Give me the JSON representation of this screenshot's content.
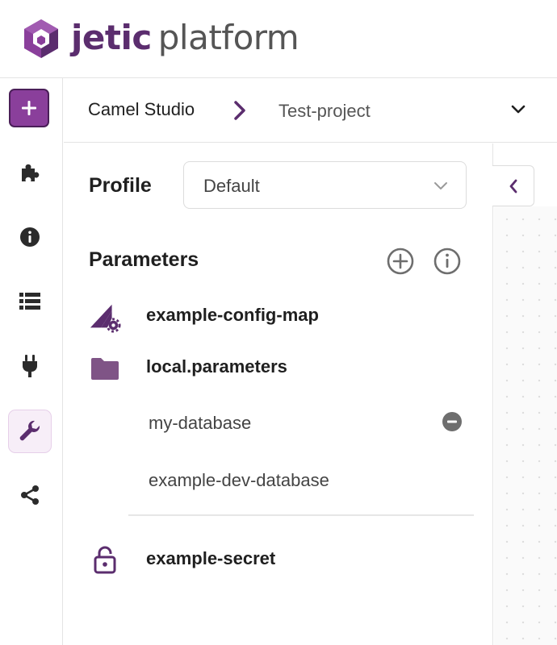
{
  "header": {
    "brand_primary": "jetic",
    "brand_secondary": "platform",
    "logo_icon": "jetic-cube-logo"
  },
  "rail": {
    "items": [
      {
        "icon": "plus-icon",
        "active": false
      },
      {
        "icon": "puzzle-icon",
        "active": false
      },
      {
        "icon": "info-icon",
        "active": false
      },
      {
        "icon": "list-icon",
        "active": false
      },
      {
        "icon": "plug-icon",
        "active": false
      },
      {
        "icon": "wrench-icon",
        "active": true
      },
      {
        "icon": "share-icon",
        "active": false
      }
    ]
  },
  "breadcrumb": {
    "root": "Camel Studio",
    "project": "Test-project"
  },
  "profile": {
    "label": "Profile",
    "selected": "Default"
  },
  "parameters": {
    "title": "Parameters",
    "items": [
      {
        "label": "example-config-map",
        "icon": "config-map-icon"
      },
      {
        "label": "local.parameters",
        "icon": "folder-icon"
      }
    ],
    "children": [
      {
        "label": "my-database",
        "removable": true
      },
      {
        "label": "example-dev-database",
        "removable": false
      }
    ],
    "secret": {
      "label": "example-secret",
      "icon": "lock-icon"
    }
  },
  "colors": {
    "accent": "#5b2d6e",
    "accent_light": "#8a3f9b",
    "icon_dark": "#2b2b2b",
    "icon_gray": "#6e6e6e"
  }
}
